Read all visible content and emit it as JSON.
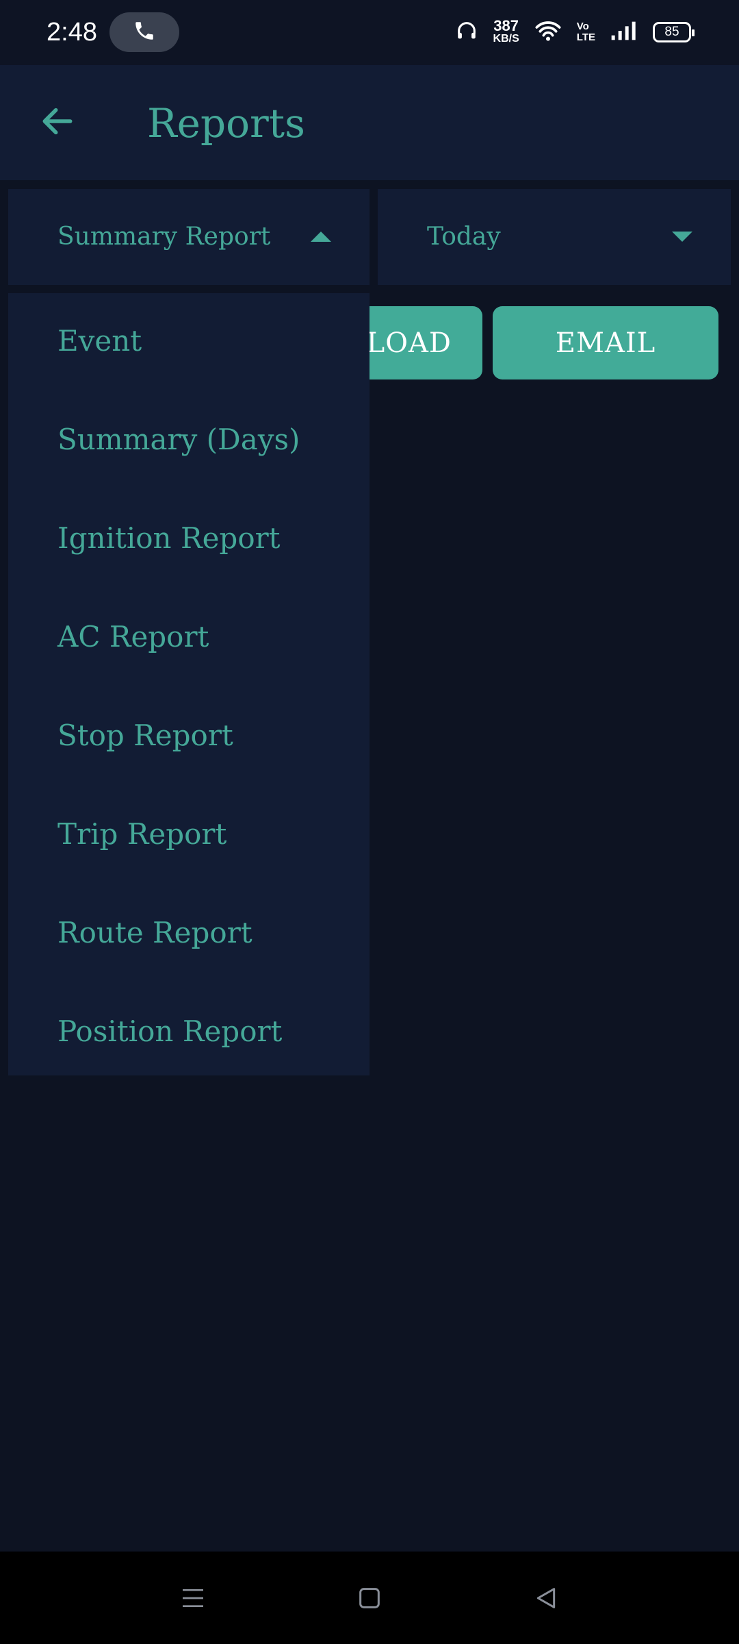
{
  "status_bar": {
    "time": "2:48",
    "net_speed": "387",
    "net_unit": "KB/S",
    "volte_top": "Vo",
    "volte_bottom": "LTE",
    "battery": "85"
  },
  "app_bar": {
    "title": "Reports",
    "back_icon": "arrow-left-icon"
  },
  "selectors": {
    "report_type": "Summary Report",
    "date_range": "Today"
  },
  "actions": {
    "download_label": "DOWNLOAD",
    "download_visible_text": "ILOAD",
    "email_label": "EMAIL"
  },
  "dropdown": {
    "items": [
      {
        "label": "Event"
      },
      {
        "label": "Summary (Days)"
      },
      {
        "label": "Ignition Report"
      },
      {
        "label": "AC Report"
      },
      {
        "label": "Stop Report"
      },
      {
        "label": "Trip Report"
      },
      {
        "label": "Route Report"
      },
      {
        "label": "Position Report"
      }
    ]
  },
  "colors": {
    "accent": "#45a898",
    "button": "#42ab98",
    "surface": "#121c34",
    "background": "#0d1322"
  },
  "nav_bar": {
    "icons": [
      "menu-icon",
      "home-square-icon",
      "back-triangle-icon"
    ]
  }
}
